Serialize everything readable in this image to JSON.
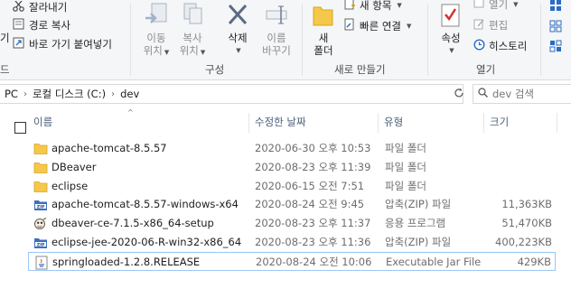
{
  "ribbon": {
    "clipboard": {
      "cut": "잘라내기",
      "copy_path": "경로 복사",
      "paste_shortcut": "바로 가기 붙여넣기",
      "partial_left": "기",
      "group_label": "드"
    },
    "organize": {
      "move_to_line1": "이동",
      "move_to_line2": "위치",
      "copy_to_line1": "복사",
      "copy_to_line2": "위치",
      "delete": "삭제",
      "rename_line1": "이름",
      "rename_line2": "바꾸기",
      "group_label": "구성"
    },
    "new": {
      "new_folder_line1": "새",
      "new_folder_line2": "폴더",
      "new_item": "새 항목",
      "easy_access": "빠른 연결",
      "group_label": "새로 만들기"
    },
    "open": {
      "properties": "속성",
      "open": "열기",
      "edit": "편집",
      "history": "히스토리",
      "group_label": "열기"
    }
  },
  "address": {
    "crumbs": [
      "PC",
      "로컬 디스크 (C:)",
      "dev"
    ],
    "search_placeholder": "dev 검색"
  },
  "columns": {
    "name": "이름",
    "date": "수정한 날짜",
    "type": "유형",
    "size": "크기"
  },
  "files": [
    {
      "name": "apache-tomcat-8.5.57",
      "date": "2020-06-30 오후 10:53",
      "type": "파일 폴더",
      "size": "",
      "icon": "folder-icon"
    },
    {
      "name": "DBeaver",
      "date": "2020-08-23 오후 11:39",
      "type": "파일 폴더",
      "size": "",
      "icon": "folder-icon"
    },
    {
      "name": "eclipse",
      "date": "2020-06-15 오전 7:51",
      "type": "파일 폴더",
      "size": "",
      "icon": "folder-icon"
    },
    {
      "name": "apache-tomcat-8.5.57-windows-x64",
      "date": "2020-08-24 오전 9:45",
      "type": "압축(ZIP) 파일",
      "size": "11,363KB",
      "icon": "zip-icon"
    },
    {
      "name": "dbeaver-ce-7.1.5-x86_64-setup",
      "date": "2020-08-23 오후 11:37",
      "type": "응용 프로그램",
      "size": "51,470KB",
      "icon": "installer-icon"
    },
    {
      "name": "eclipse-jee-2020-06-R-win32-x86_64",
      "date": "2020-08-23 오후 11:36",
      "type": "압축(ZIP) 파일",
      "size": "400,223KB",
      "icon": "zip-icon"
    },
    {
      "name": "springloaded-1.2.8.RELEASE",
      "date": "2020-08-24 오전 10:06",
      "type": "Executable Jar File",
      "size": "429KB",
      "icon": "jar-icon",
      "selected": true
    }
  ],
  "colors": {
    "folder": "#f5c84a",
    "selection_border": "#99c8f5",
    "header_text": "#4c607a",
    "accent_blue": "#2b6cc4"
  }
}
